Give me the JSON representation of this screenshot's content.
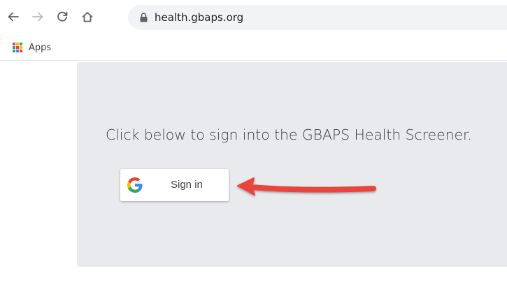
{
  "browser": {
    "back_icon": "arrow-left-icon",
    "forward_icon": "arrow-right-icon",
    "reload_icon": "reload-icon",
    "home_icon": "home-icon",
    "lock_icon": "lock-icon",
    "url": "health.gbaps.org"
  },
  "bookmarks": {
    "apps_label": "Apps",
    "apps_icon": "apps-grid-icon"
  },
  "page": {
    "headline": "Click below to sign into the GBAPS Health Screener.",
    "signin_label": "Sign in",
    "signin_icon": "google-g-icon",
    "annotation": "red-arrow-icon"
  },
  "colors": {
    "content_bg": "#e8eaed",
    "arrow": "#e8453c",
    "omnibox_bg": "#f1f3f4"
  }
}
